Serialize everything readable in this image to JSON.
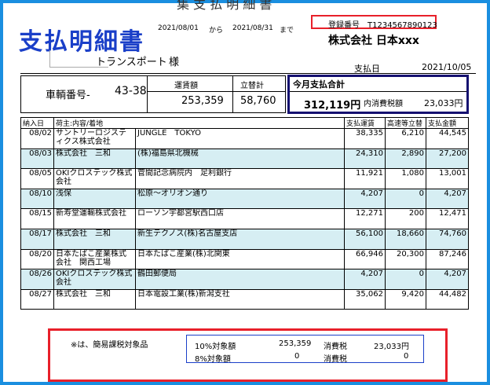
{
  "header": {
    "title": "支払明細書",
    "cut_title": "集 支 払 明 細 書",
    "period_from": "2021/08/01",
    "kara": "から",
    "period_to": "2021/08/31",
    "made": "まで",
    "registration": "登録番号　T1234567890123",
    "company": "株式会社 日本xxx",
    "customer": "トランスポート",
    "honorific": "様",
    "payment_date_label": "支払日",
    "payment_date": "2021/10/05"
  },
  "vehicle": {
    "label": "車輌番号-",
    "number": "43-38",
    "fee_label": "運賃額",
    "fee_value": "253,359",
    "advance_label": "立替計",
    "advance_value": "58,760"
  },
  "total": {
    "label": "今月支払合計",
    "value": "312,119円",
    "tax_label": "内消費税額",
    "tax_value": "23,033円"
  },
  "table": {
    "columns": [
      "納入日",
      "荷主:内容/着地",
      "",
      "支払運賃",
      "高速等立替",
      "支払金額"
    ],
    "rows": [
      {
        "date": "08/02",
        "shipper": "サントリーロジスティクス株式会社",
        "dest": "JUNGLE　TOKYO",
        "fare": "38,335",
        "toll": "6,210",
        "amount": "44,545"
      },
      {
        "date": "08/03",
        "shipper": "株式会社　三和",
        "dest": "(株)福島県北機械",
        "fare": "24,310",
        "toll": "2,890",
        "amount": "27,200"
      },
      {
        "date": "08/05",
        "shipper": "OKIクロステック株式会社",
        "dest": "菅間記念病院内　足利銀行",
        "fare": "11,921",
        "toll": "1,080",
        "amount": "13,001"
      },
      {
        "date": "08/10",
        "shipper": "浅保",
        "dest": "松原～オリオン通り",
        "fare": "4,207",
        "toll": "0",
        "amount": "4,207"
      },
      {
        "date": "08/15",
        "shipper": "新寿堂運輸株式会社",
        "dest": "ローソン宇都宮駅西口店",
        "fare": "12,271",
        "toll": "200",
        "amount": "12,471"
      },
      {
        "date": "08/17",
        "shipper": "株式会社　三和",
        "dest": "新生テクノス(株)名古屋支店",
        "fare": "56,100",
        "toll": "18,660",
        "amount": "74,760"
      },
      {
        "date": "08/20",
        "shipper": "日本たばこ産業株式会社　関西工場",
        "dest": "日本たばこ産業(株)北関東",
        "fare": "66,946",
        "toll": "20,300",
        "amount": "87,246"
      },
      {
        "date": "08/26",
        "shipper": "OKIクロステック株式会社",
        "dest": "鶴田郵便局",
        "fare": "4,207",
        "toll": "0",
        "amount": "4,207"
      },
      {
        "date": "08/27",
        "shipper": "株式会社　三和",
        "dest": "日本電設工業(株)新潟支社",
        "fare": "35,062",
        "toll": "9,420",
        "amount": "44,482"
      }
    ]
  },
  "footer": {
    "note": "※は、簡易課税対象品",
    "r10_label": "10%対象額",
    "r10_value": "253,359",
    "r10_tax_label": "消費税",
    "r10_tax_value": "23,033円",
    "r8_label": "8%対象額",
    "r8_value": "0",
    "r8_tax_label": "消費税",
    "r8_tax_value": "0"
  },
  "colors": {
    "frame": "#1a8fe0",
    "title": "#1a3fc8",
    "highlight_red": "#e8202a",
    "total_border": "#151070",
    "row_shade": "#d6eef3"
  }
}
